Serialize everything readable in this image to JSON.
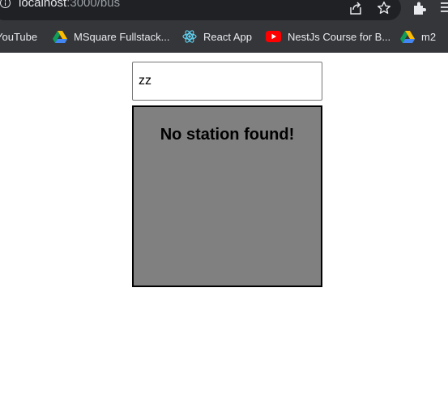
{
  "browser": {
    "url_host": "localhost",
    "url_path": ":3000/bus",
    "bookmarks": [
      {
        "label": "YouTube",
        "icon": "youtube-icon"
      },
      {
        "label": "MSquare Fullstack...",
        "icon": "google-drive-icon"
      },
      {
        "label": "React App",
        "icon": "react-icon"
      },
      {
        "label": "NestJs Course for B...",
        "icon": "youtube-icon"
      },
      {
        "label": "m2",
        "icon": "google-drive-icon"
      }
    ],
    "toolbar_icons": [
      "info-icon",
      "share-icon",
      "star-icon",
      "extensions-icon",
      "menu-icon"
    ]
  },
  "search": {
    "value": "zz"
  },
  "result": {
    "message": "No station found!",
    "background": "#808080"
  }
}
